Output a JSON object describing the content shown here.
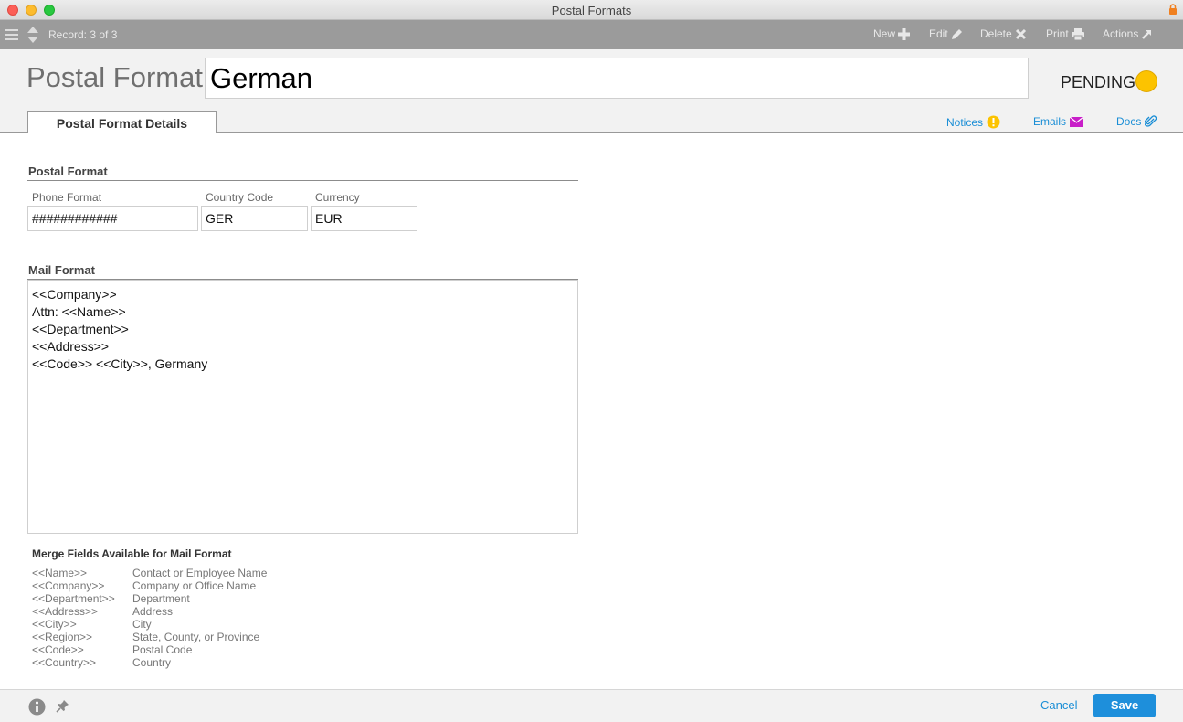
{
  "window": {
    "title": "Postal Formats"
  },
  "toolbar": {
    "record": "Record: 3 of 3",
    "new_label": "New",
    "edit_label": "Edit",
    "delete_label": "Delete",
    "print_label": "Print",
    "actions_label": "Actions"
  },
  "header": {
    "label": "Postal Format:",
    "name_value": "German",
    "status": "PENDING",
    "status_color": "#fcc300",
    "tab": "Postal Format Details",
    "links": {
      "notices": "Notices",
      "emails": "Emails",
      "docs": "Docs"
    }
  },
  "postal_format": {
    "section_title": "Postal Format",
    "phone_label": "Phone Format",
    "phone_value": "############",
    "country_label": "Country Code",
    "country_value": "GER",
    "currency_label": "Currency",
    "currency_value": "EUR"
  },
  "mail_format": {
    "section_title": "Mail Format",
    "lines": [
      "<<Company>>",
      "Attn: <<Name>>",
      "<<Department>>",
      "<<Address>>",
      "<<Code>> <<City>>, Germany"
    ]
  },
  "merge_fields": {
    "title": "Merge Fields Available for Mail Format",
    "rows": [
      {
        "code": "<<Name>>",
        "desc": "Contact or Employee Name"
      },
      {
        "code": "<<Company>>",
        "desc": "Company or Office Name"
      },
      {
        "code": "<<Department>>",
        "desc": "Department"
      },
      {
        "code": "<<Address>>",
        "desc": "Address"
      },
      {
        "code": "<<City>>",
        "desc": "City"
      },
      {
        "code": "<<Region>>",
        "desc": "State, County, or Province"
      },
      {
        "code": "<<Code>>",
        "desc": "Postal Code"
      },
      {
        "code": "<<Country>>",
        "desc": "Country"
      }
    ]
  },
  "footer": {
    "cancel_label": "Cancel",
    "save_label": "Save"
  },
  "colors": {
    "accent": "#1e8fdb",
    "toolbar": "#9b9b9b",
    "notice": "#fcc300",
    "email": "#c81ec8"
  }
}
